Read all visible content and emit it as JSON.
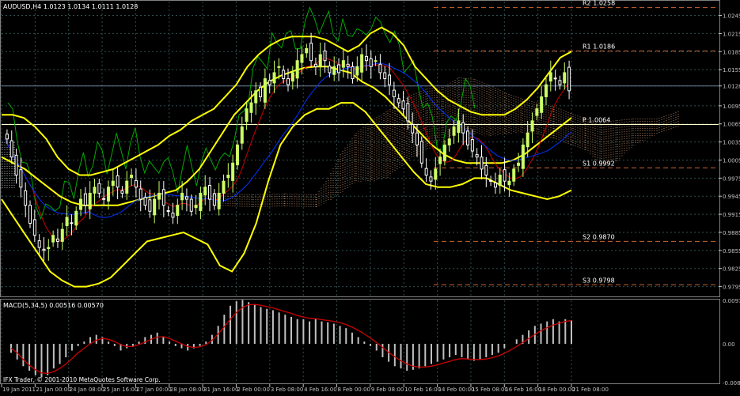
{
  "window": {
    "symbol_header": "AUDUSD,H4  1.0123 1.0134 1.0111 1.0128",
    "macd_header": "MACD(5,34,5) 0.00516 0.00570",
    "copyright": "IFX Trader, © 2001-2010 MetaQuotes Software Corp."
  },
  "colors": {
    "background": "#000000",
    "grid": "#2f4f4f",
    "axis_text": "#c0c0c0",
    "bull_candle": "#ccff66",
    "bear_candle": "#ffffff",
    "bollinger": "#ffff00",
    "ma_green": "#00aa00",
    "ma_red": "#cc0000",
    "ma_blue": "#0033ff",
    "pivot_lines": "#cc6633",
    "pivot_main": "#ffffcc",
    "kumo": "#a0785a",
    "macd_bars": "#c0c0c0",
    "macd_signal": "#cc0000",
    "current_price_line": "#6b7f9a"
  },
  "pivots": [
    {
      "label": "R2 1.0258",
      "value": 1.0258
    },
    {
      "label": "R1 1.0186",
      "value": 1.0186
    },
    {
      "label": "P 1.0064",
      "value": 1.0064
    },
    {
      "label": "S1 0.9992",
      "value": 0.9992
    },
    {
      "label": "S2 0.9870",
      "value": 0.987
    },
    {
      "label": "S3 0.9798",
      "value": 0.9798
    }
  ],
  "chart_data": {
    "type": "candlestick",
    "symbol": "AUDUSD",
    "timeframe": "H4",
    "last_ohlc": {
      "open": 1.0123,
      "high": 1.0134,
      "low": 1.0111,
      "close": 1.0128
    },
    "current_price": 1.0128,
    "price_axis_ticks": [
      "1.0245",
      "1.0215",
      "1.0185",
      "1.0155",
      "1.0128",
      "1.0095",
      "1.0065",
      "1.0035",
      "1.0005",
      "0.9975",
      "0.9945",
      "0.9915",
      "0.9885",
      "0.9855",
      "0.9825",
      "0.9795"
    ],
    "price_axis_values": [
      1.0245,
      1.0215,
      1.0185,
      1.0155,
      1.0128,
      1.0095,
      1.0065,
      1.0035,
      1.0005,
      0.9975,
      0.9945,
      0.9915,
      0.9885,
      0.9855,
      0.9825,
      0.9795
    ],
    "ylim": [
      0.978,
      1.0268
    ],
    "time_axis_ticks": [
      "19 Jan 2011",
      "21 Jan 00:00",
      "24 Jan 08:00",
      "25 Jan 16:00",
      "27 Jan 00:00",
      "28 Jan 08:00",
      "31 Jan 16:00",
      "2 Feb 00:00",
      "3 Feb 08:00",
      "4 Feb 16:00",
      "8 Feb 00:00",
      "9 Feb 08:00",
      "10 Feb 16:00",
      "14 Feb 00:00",
      "15 Feb 08:00",
      "16 Feb 16:00",
      "18 Feb 00:00",
      "21 Feb 08:00"
    ],
    "close_series": [
      1.004,
      1.001,
      0.998,
      0.996,
      0.993,
      0.99,
      0.988,
      0.986,
      0.9855,
      0.986,
      0.988,
      0.987,
      0.989,
      0.991,
      0.99,
      0.992,
      0.994,
      0.993,
      0.995,
      0.996,
      0.995,
      0.994,
      0.996,
      0.997,
      0.996,
      0.995,
      0.997,
      0.998,
      0.996,
      0.994,
      0.993,
      0.992,
      0.994,
      0.995,
      0.993,
      0.992,
      0.991,
      0.993,
      0.995,
      0.994,
      0.992,
      0.993,
      0.995,
      0.996,
      0.994,
      0.993,
      0.995,
      0.997,
      0.998,
      1.0,
      1.003,
      1.006,
      1.009,
      1.01,
      1.012,
      1.011,
      1.014,
      1.013,
      1.015,
      1.016,
      1.014,
      1.013,
      1.015,
      1.017,
      1.018,
      1.019,
      1.017,
      1.016,
      1.018,
      1.017,
      1.015,
      1.016,
      1.015,
      1.017,
      1.016,
      1.014,
      1.016,
      1.018,
      1.017,
      1.016,
      1.017,
      1.015,
      1.014,
      1.013,
      1.011,
      1.01,
      1.009,
      1.007,
      1.005,
      1.003,
      1.0,
      0.998,
      0.997,
      0.999,
      1.001,
      1.003,
      1.004,
      1.006,
      1.007,
      1.005,
      1.003,
      1.002,
      1.001,
      0.999,
      0.998,
      0.997,
      0.996,
      0.998,
      0.997,
      0.997,
      0.999,
      1.0,
      1.003,
      1.005,
      1.007,
      1.009,
      1.011,
      1.013,
      1.015,
      1.014,
      1.013,
      1.015,
      1.012
    ],
    "bollinger": {
      "upper": [
        1.008,
        1.008,
        1.0075,
        1.006,
        1.004,
        1.001,
        0.999,
        0.998,
        0.998,
        0.9985,
        0.999,
        1.0,
        1.001,
        1.002,
        1.003,
        1.0045,
        1.0055,
        1.007,
        1.008,
        1.009,
        1.011,
        1.013,
        1.016,
        1.018,
        1.0195,
        1.0205,
        1.021,
        1.021,
        1.021,
        1.0205,
        1.0195,
        1.0185,
        1.0195,
        1.0215,
        1.0225,
        1.0215,
        1.0195,
        1.016,
        1.014,
        1.012,
        1.0105,
        1.0095,
        1.0085,
        1.008,
        1.008,
        1.008,
        1.009,
        1.0105,
        1.0125,
        1.015,
        1.0175,
        1.0185
      ],
      "middle": [
        1.001,
        1.0,
        0.999,
        0.9975,
        0.996,
        0.9945,
        0.9935,
        0.993,
        0.993,
        0.993,
        0.993,
        0.9935,
        0.994,
        0.9945,
        0.995,
        0.9955,
        0.997,
        0.999,
        1.002,
        1.005,
        1.008,
        1.01,
        1.012,
        1.0135,
        1.0145,
        1.0152,
        1.0158,
        1.016,
        1.016,
        1.0155,
        1.015,
        1.0135,
        1.0125,
        1.011,
        1.009,
        1.007,
        1.005,
        1.003,
        1.0015,
        1.0005,
        1.0,
        1.0,
        1.0,
        1.0,
        1.0005,
        1.0015,
        1.003,
        1.0045,
        1.006,
        1.0075
      ],
      "lower": [
        0.994,
        0.991,
        0.988,
        0.985,
        0.982,
        0.9805,
        0.9795,
        0.9795,
        0.98,
        0.981,
        0.983,
        0.985,
        0.987,
        0.9875,
        0.988,
        0.9885,
        0.9875,
        0.9865,
        0.983,
        0.982,
        0.985,
        0.99,
        0.997,
        1.003,
        1.006,
        1.008,
        1.009,
        1.009,
        1.01,
        1.01,
        1.0085,
        1.006,
        1.0035,
        1.001,
        0.9985,
        0.9965,
        0.996,
        0.996,
        0.9965,
        0.9975,
        0.9975,
        0.9965,
        0.9955,
        0.995,
        0.9945,
        0.994,
        0.9945,
        0.9955
      ]
    },
    "macd": {
      "value": 0.00516,
      "signal_value": 0.0057,
      "axis_ticks": [
        "0.00970",
        "0.00",
        "-0.00865"
      ],
      "axis_values": [
        0.0097,
        0.0,
        -0.00865
      ],
      "histogram": [
        -0.002,
        -0.0035,
        -0.005,
        -0.006,
        -0.007,
        -0.0075,
        -0.007,
        -0.0055,
        -0.0045,
        -0.003,
        -0.0015,
        -0.0005,
        0.0005,
        0.0015,
        0.002,
        0.0015,
        0.0005,
        -0.0005,
        -0.0015,
        -0.001,
        -0.0005,
        0.0005,
        0.0015,
        0.002,
        0.0025,
        0.0015,
        0.0005,
        -0.0005,
        -0.001,
        -0.0015,
        -0.001,
        -0.0005,
        0.0005,
        0.002,
        0.004,
        0.0065,
        0.0085,
        0.0095,
        0.0098,
        0.0093,
        0.0087,
        0.0082,
        0.0078,
        0.0075,
        0.007,
        0.0065,
        0.006,
        0.0055,
        0.0055,
        0.005,
        0.0055,
        0.005,
        0.0048,
        0.0045,
        0.004,
        0.0035,
        0.0025,
        0.0015,
        0.0005,
        -0.0005,
        -0.0015,
        -0.003,
        -0.004,
        -0.005,
        -0.0055,
        -0.006,
        -0.0058,
        -0.0055,
        -0.005,
        -0.0045,
        -0.004,
        -0.0035,
        -0.003,
        -0.0025,
        -0.003,
        -0.0035,
        -0.0038,
        -0.0035,
        -0.003,
        -0.0025,
        -0.002,
        -0.001,
        0.0,
        0.001,
        0.002,
        0.003,
        0.004,
        0.0045,
        0.005,
        0.0055,
        0.005,
        0.0055,
        0.0052
      ],
      "signal": [
        -0.001,
        -0.002,
        -0.0035,
        -0.0048,
        -0.0058,
        -0.0065,
        -0.0066,
        -0.0062,
        -0.0055,
        -0.0045,
        -0.0033,
        -0.002,
        -0.001,
        0.0,
        0.0008,
        0.0012,
        0.001,
        0.0005,
        -0.0002,
        -0.0006,
        -0.0006,
        -0.0002,
        0.0004,
        0.001,
        0.0015,
        0.0016,
        0.0012,
        0.0006,
        0.0,
        -0.0006,
        -0.0008,
        -0.0007,
        -0.0002,
        0.0008,
        0.0022,
        0.0038,
        0.0055,
        0.007,
        0.0081,
        0.0087,
        0.0088,
        0.0086,
        0.0083,
        0.008,
        0.0076,
        0.0072,
        0.0068,
        0.0063,
        0.006,
        0.0057,
        0.0056,
        0.0054,
        0.0052,
        0.005,
        0.0047,
        0.0043,
        0.0037,
        0.003,
        0.0022,
        0.0013,
        0.0003,
        -0.0008,
        -0.0019,
        -0.0029,
        -0.0038,
        -0.0045,
        -0.005,
        -0.0052,
        -0.0052,
        -0.005,
        -0.0047,
        -0.0043,
        -0.0039,
        -0.0035,
        -0.0033,
        -0.0034,
        -0.0035,
        -0.0035,
        -0.0034,
        -0.0031,
        -0.0027,
        -0.0021,
        -0.0014,
        -0.0006,
        0.0003,
        0.0012,
        0.0021,
        0.0029,
        0.0036,
        0.0042,
        0.0046,
        0.005,
        0.0052
      ]
    }
  }
}
